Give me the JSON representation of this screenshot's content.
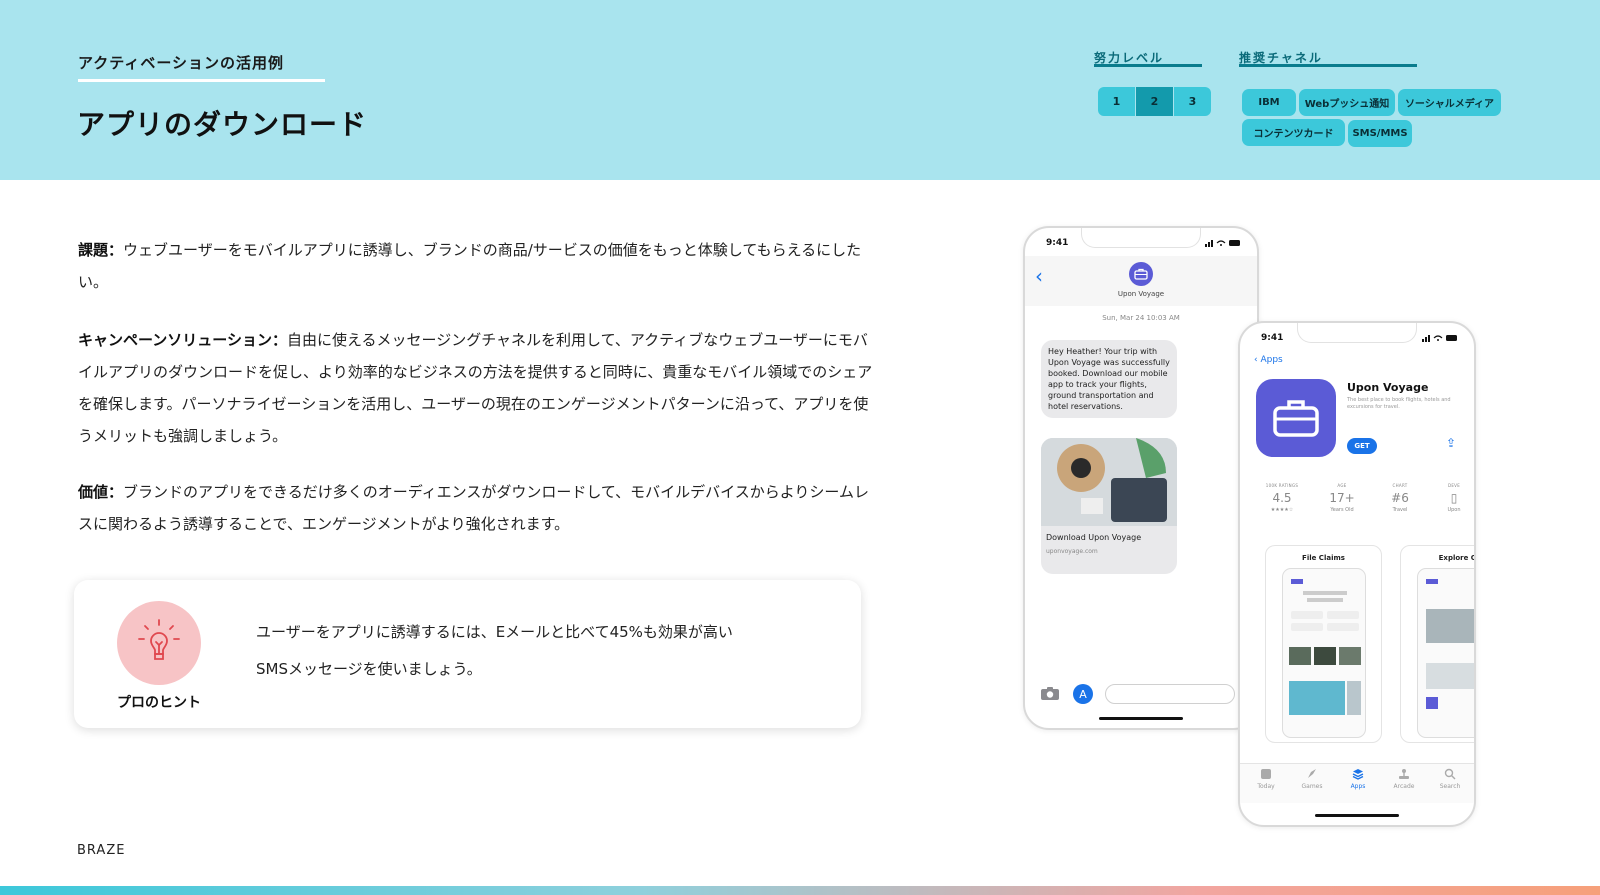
{
  "header": {
    "eyebrow": "アクティベーションの活用例",
    "title": "アプリのダウンロード",
    "effort_label": "努力レベル",
    "effort_levels": [
      "1",
      "2",
      "3"
    ],
    "effort_selected": 2,
    "channels_label": "推奨チャネル",
    "channels": [
      "IBM",
      "Webプッシュ通知",
      "ソーシャルメディア",
      "コンテンツカード",
      "SMS/MMS"
    ]
  },
  "body": {
    "challenge_label": "課題：",
    "challenge_text": "ウェブユーザーをモバイルアプリに誘導し、ブランドの商品/サービスの価値をもっと体験してもらえるにしたい。",
    "solution_label": "キャンペーンソリューション：",
    "solution_text": "自由に使えるメッセージングチャネルを利用して、アクティブなウェブユーザーにモバイルアプリのダウンロードを促し、より効率的なビジネスの方法を提供すると同時に、貴重なモバイル領域でのシェアを確保します。パーソナライゼーションを活用し、ユーザーの現在のエンゲージメントパターンに沿って、アプリを使うメリットも強調しましょう。",
    "value_label": "価値：",
    "value_text": "ブランドのアプリをできるだけ多くのオーディエンスがダウンロードして、モバイルデバイスからよりシームレスに関わるよう誘導することで、エンゲージメントがより強化されます。"
  },
  "tip": {
    "label": "プロのヒント",
    "line1": "ユーザーをアプリに誘導するには、Eメールと比べて45%も効果が高い",
    "line2": "SMSメッセージを使いましょう。",
    "icon": "lightbulb-icon"
  },
  "phone_sms": {
    "time": "9:41",
    "contact": "Upon Voyage",
    "date": "Sun, Mar 24  10:03 AM",
    "message": "Hey Heather! Your trip with Upon Voyage was successfully booked. Download our mobile app to track your flights, ground transportation and hotel reservations.",
    "link_title": "Download Upon Voyage",
    "link_url": "uponvoyage.com"
  },
  "phone_store": {
    "time": "9:41",
    "back": "Apps",
    "app_name": "Upon Voyage",
    "app_sub": "The best place to book flights, hotels and excursions for travel.",
    "get": "GET",
    "stats": [
      {
        "k": "100K RATINGS",
        "v": "4.5",
        "s": "★★★★☆"
      },
      {
        "k": "AGE",
        "v": "17+",
        "s": "Years Old"
      },
      {
        "k": "CHART",
        "v": "#6",
        "s": "Travel"
      },
      {
        "k": "DEVE",
        "v": "▯",
        "s": "Upon"
      }
    ],
    "shots": [
      "File Claims",
      "Explore Cl"
    ],
    "tabs": [
      "Today",
      "Games",
      "Apps",
      "Arcade",
      "Search"
    ],
    "active_tab": 2
  },
  "footer": {
    "brand": "BRAZE"
  },
  "colors": {
    "header_bg": "#a9e4ee",
    "chip": "#3cc8da",
    "chip_active": "#139aac",
    "app_purple": "#5b5bd6",
    "ios_blue": "#1a73e8",
    "tip_pink": "#f7c4c6"
  }
}
